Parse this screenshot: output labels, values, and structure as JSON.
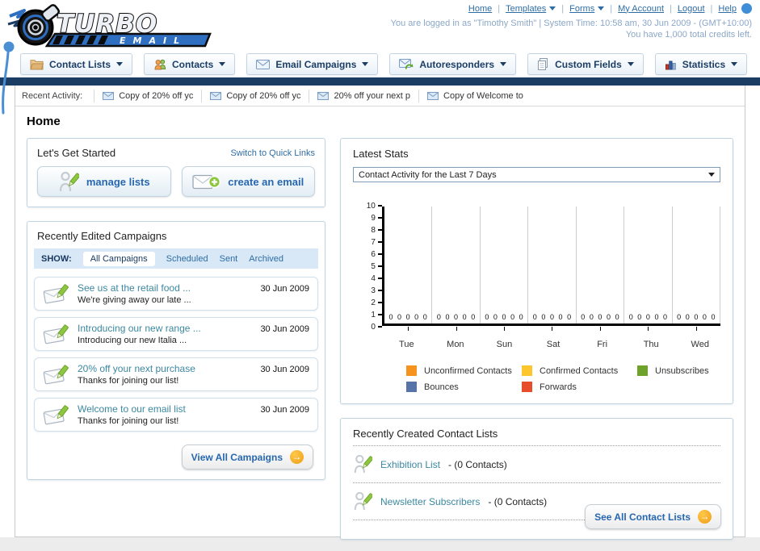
{
  "header": {
    "logo_title": "TURBO",
    "logo_subtitle": "EMAIL",
    "nav": {
      "home": "Home",
      "templates": "Templates",
      "forms": "Forms",
      "my_account": "My Account",
      "logout": "Logout",
      "help": "Help"
    },
    "login_line": "You are logged in as \"Timothy Smith\" | System Time: 10:58 am, 30 Jun 2009 - (GMT+10:00)",
    "credits_line": "You have 1,000 total credits left."
  },
  "tabs": [
    {
      "label": "Contact Lists",
      "icon": "folder-icon"
    },
    {
      "label": "Contacts",
      "icon": "people-icon"
    },
    {
      "label": "Email Campaigns",
      "icon": "envelope-icon"
    },
    {
      "label": "Autoresponders",
      "icon": "envelope-arrow-icon"
    },
    {
      "label": "Custom Fields",
      "icon": "pages-icon"
    },
    {
      "label": "Statistics",
      "icon": "bar-chart-icon"
    }
  ],
  "recent_activity": {
    "label": "Recent Activity:",
    "items": [
      {
        "text": "Copy of 20% off yc"
      },
      {
        "text": "Copy of 20% off yc"
      },
      {
        "text": "20% off your next p"
      },
      {
        "text": "Copy of Welcome to"
      }
    ]
  },
  "page_title": "Home",
  "get_started": {
    "title": "Let's Get Started",
    "switch_link": "Switch to Quick Links",
    "manage_lists_label": "manage lists",
    "create_email_label": "create an email"
  },
  "campaigns": {
    "title": "Recently Edited Campaigns",
    "show_label": "SHOW:",
    "filters": [
      {
        "label": "All Campaigns"
      },
      {
        "label": "Scheduled"
      },
      {
        "label": "Sent"
      },
      {
        "label": "Archived"
      }
    ],
    "active_filter": "All Campaigns",
    "items": [
      {
        "title": "See us at the retail food ...",
        "subtitle": "We're giving away our late ...",
        "date": "30 Jun 2009"
      },
      {
        "title": "Introducing our new range ...",
        "subtitle": "Introducing our new Italia ...",
        "date": "30 Jun 2009"
      },
      {
        "title": "20% off your next purchase",
        "subtitle": "Thanks for joining our list!",
        "date": "30 Jun 2009"
      },
      {
        "title": "Welcome to our email list",
        "subtitle": "Thanks for joining our list!",
        "date": "30 Jun 2009"
      }
    ],
    "view_all_label": "View All Campaigns"
  },
  "stats": {
    "title": "Latest Stats",
    "dropdown_value": "Contact Activity for the Last 7 Days"
  },
  "chart_data": {
    "type": "bar",
    "title": "Contact Activity for the Last 7 Days",
    "categories": [
      "Tue",
      "Mon",
      "Sun",
      "Sat",
      "Fri",
      "Thu",
      "Wed"
    ],
    "series": [
      {
        "name": "Unconfirmed Contacts",
        "color": "#F6921E",
        "values": [
          0,
          0,
          0,
          0,
          0,
          0,
          0
        ]
      },
      {
        "name": "Confirmed Contacts",
        "color": "#FDC62F",
        "values": [
          0,
          0,
          0,
          0,
          0,
          0,
          0
        ]
      },
      {
        "name": "Unsubscribes",
        "color": "#6FA22B",
        "values": [
          0,
          0,
          0,
          0,
          0,
          0,
          0
        ]
      },
      {
        "name": "Bounces",
        "color": "#5873A8",
        "values": [
          0,
          0,
          0,
          0,
          0,
          0,
          0
        ]
      },
      {
        "name": "Forwards",
        "color": "#E74C2B",
        "values": [
          0,
          0,
          0,
          0,
          0,
          0,
          0
        ]
      }
    ],
    "xlabel": "",
    "ylabel": "",
    "ylim": [
      0,
      10
    ],
    "y_ticks": [
      0,
      1,
      2,
      3,
      4,
      5,
      6,
      7,
      8,
      9,
      10
    ],
    "grid": true,
    "legend_position": "bottom",
    "value_labels_shown": true
  },
  "contact_lists": {
    "title": "Recently Created Contact Lists",
    "items": [
      {
        "name": "Exhibition List",
        "count": "- (0 Contacts)"
      },
      {
        "name": "Newsletter Subscribers",
        "count": "- (0 Contacts)"
      }
    ],
    "see_all_label": "See All Contact Lists"
  }
}
